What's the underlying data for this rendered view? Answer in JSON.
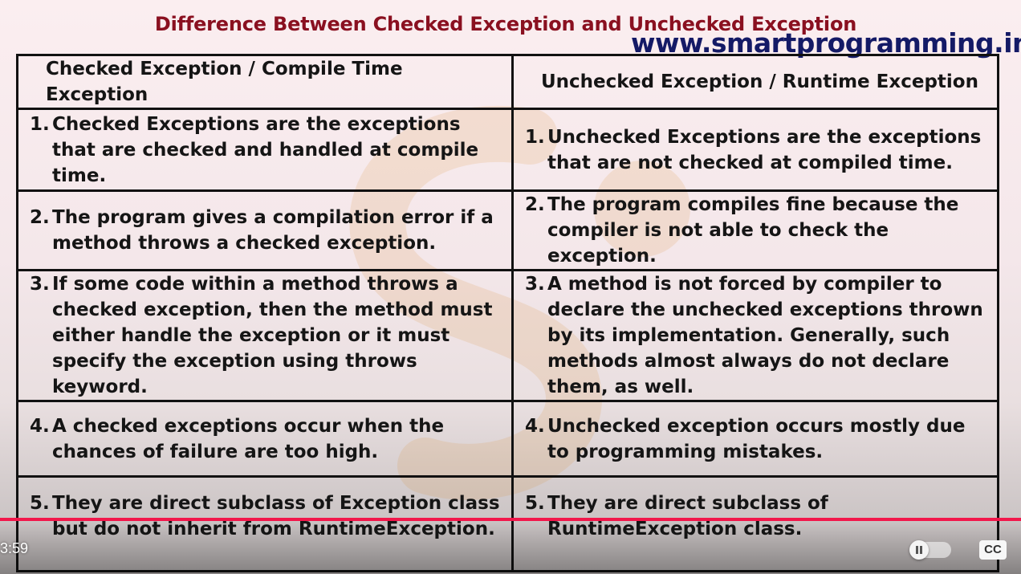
{
  "slide": {
    "title": "Difference Between Checked Exception and Unchecked Exception",
    "website": "www.smartprogramming.in",
    "columns": [
      "Checked Exception / Compile Time Exception",
      "Unchecked Exception / Runtime Exception"
    ],
    "rows": [
      {
        "checked": {
          "num": "1.",
          "text": "Checked Exceptions are the exceptions that are checked and handled at compile time."
        },
        "unchecked": {
          "num": "1.",
          "text": "Unchecked Exceptions are the exceptions that are not checked at compiled time."
        }
      },
      {
        "checked": {
          "num": "2.",
          "text": "The program gives a compilation error if a method throws a checked exception."
        },
        "unchecked": {
          "num": "2.",
          "text": "The program compiles fine because the compiler is not able to check the exception."
        }
      },
      {
        "checked": {
          "num": "3.",
          "text": "If some code within a method throws a checked exception, then the method must either handle the exception or it must specify the exception using throws keyword."
        },
        "unchecked": {
          "num": "3.",
          "text": "A method is not forced by compiler to declare the unchecked exceptions thrown by its implementation. Generally, such methods almost always do not declare them, as well."
        }
      },
      {
        "checked": {
          "num": "4.",
          "text": "A checked exceptions occur when the chances of failure are too high."
        },
        "unchecked": {
          "num": "4.",
          "text": "Unchecked exception occurs mostly due to programming mistakes."
        }
      },
      {
        "checked": {
          "num": "5.",
          "text": "They are direct subclass of Exception class but do not inherit from RuntimeException."
        },
        "unchecked": {
          "num": "5.",
          "text": "They are direct subclass of RuntimeException class."
        }
      }
    ]
  },
  "player": {
    "current_time": "3:59",
    "cc_label": "CC",
    "progress_color": "#f2164a",
    "autoplay_icon": "pause-icon"
  },
  "colors": {
    "title": "#8a1020",
    "website": "#141a66",
    "table_border": "#111111"
  }
}
